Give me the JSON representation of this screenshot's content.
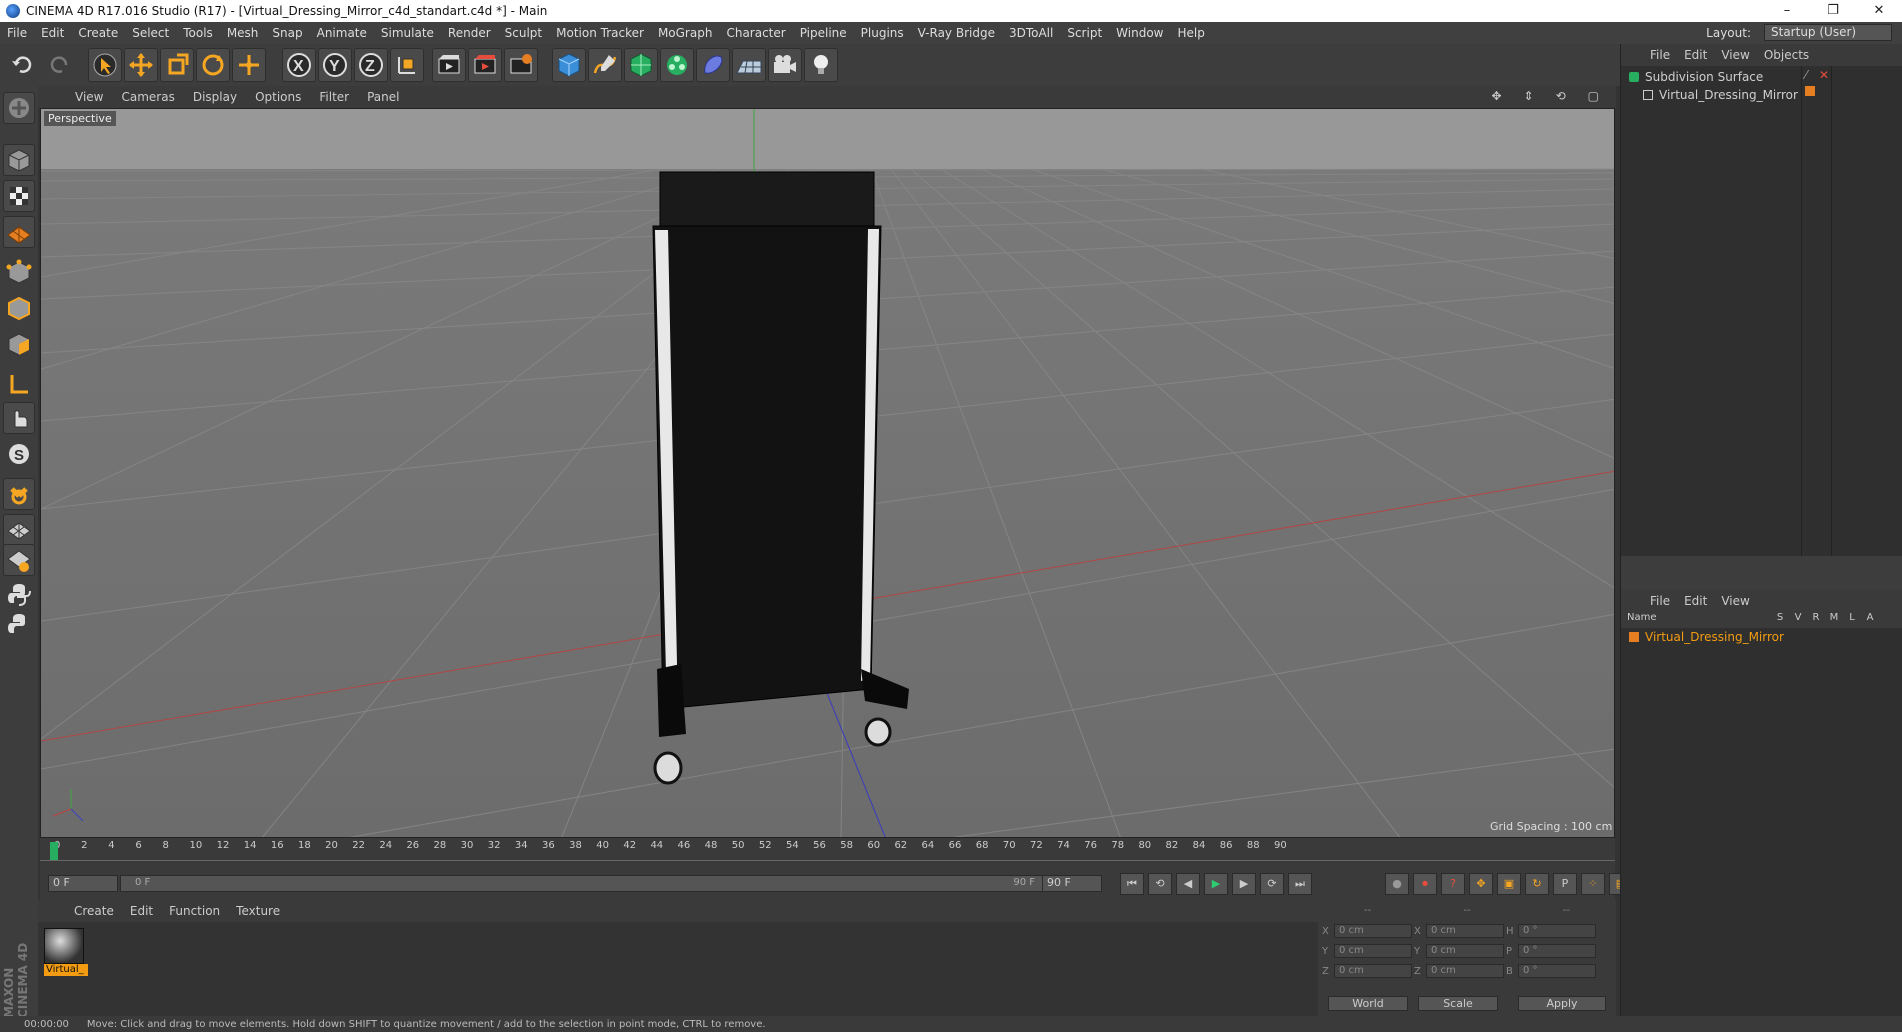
{
  "window": {
    "title": "CINEMA 4D R17.016 Studio (R17) - [Virtual_Dressing_Mirror_c4d_standart.c4d *] - Main",
    "minimize": "–",
    "maximize": "❐",
    "close": "✕"
  },
  "menu": [
    "File",
    "Edit",
    "Create",
    "Select",
    "Tools",
    "Mesh",
    "Snap",
    "Animate",
    "Simulate",
    "Render",
    "Sculpt",
    "Motion Tracker",
    "MoGraph",
    "Character",
    "Pipeline",
    "Plugins",
    "V-Ray Bridge",
    "3DToAll",
    "Script",
    "Window",
    "Help"
  ],
  "layout": {
    "label": "Layout:",
    "value": "Startup (User)"
  },
  "viewport": {
    "menu": [
      "View",
      "Cameras",
      "Display",
      "Options",
      "Filter",
      "Panel"
    ],
    "label": "Perspective",
    "grid_spacing": "Grid Spacing : 100 cm"
  },
  "timeline": {
    "ticks": [
      "0",
      "2",
      "4",
      "6",
      "8",
      "10",
      "12",
      "14",
      "16",
      "18",
      "20",
      "22",
      "24",
      "26",
      "28",
      "30",
      "32",
      "34",
      "36",
      "38",
      "40",
      "42",
      "44",
      "46",
      "48",
      "50",
      "52",
      "54",
      "56",
      "58",
      "60",
      "62",
      "64",
      "66",
      "68",
      "70",
      "72",
      "74",
      "76",
      "78",
      "80",
      "82",
      "84",
      "86",
      "88",
      "90"
    ],
    "current_frame": "0 F",
    "start_frame": "0 F",
    "range_start": "0 F",
    "range_end": "90 F",
    "end_frame": "90 F"
  },
  "material_menu": [
    "Create",
    "Edit",
    "Function",
    "Texture"
  ],
  "material": {
    "name": "Virtual_"
  },
  "coords": {
    "header": [
      "--",
      "--",
      "--"
    ],
    "rows": [
      {
        "a": "X",
        "av": "0 cm",
        "b": "X",
        "bv": "0 cm",
        "c": "H",
        "cv": "0 °"
      },
      {
        "a": "Y",
        "av": "0 cm",
        "b": "Y",
        "bv": "0 cm",
        "c": "P",
        "cv": "0 °"
      },
      {
        "a": "Z",
        "av": "0 cm",
        "b": "Z",
        "bv": "0 cm",
        "c": "B",
        "cv": "0 °"
      }
    ],
    "world": "World",
    "scale": "Scale",
    "apply": "Apply"
  },
  "objects_panel": {
    "menu": [
      "File",
      "Edit",
      "View",
      "Objects"
    ],
    "items": [
      {
        "name": "Subdivision Surface"
      },
      {
        "name": "Virtual_Dressing_Mirror"
      }
    ]
  },
  "attributes_panel": {
    "menu": [
      "File",
      "Edit",
      "View"
    ],
    "columns": [
      "Name",
      "S",
      "V",
      "R",
      "M",
      "L",
      "A"
    ],
    "item": "Virtual_Dressing_Mirror"
  },
  "status": {
    "time": "00:00:00",
    "message": "Move: Click and drag to move elements. Hold down SHIFT to quantize movement / add to the selection in point mode, CTRL to remove."
  },
  "brand": "MAXON CINEMA 4D",
  "colors": {
    "accent": "#f39c12",
    "bg": "#3d3d3d",
    "selected": "#e8a020"
  }
}
